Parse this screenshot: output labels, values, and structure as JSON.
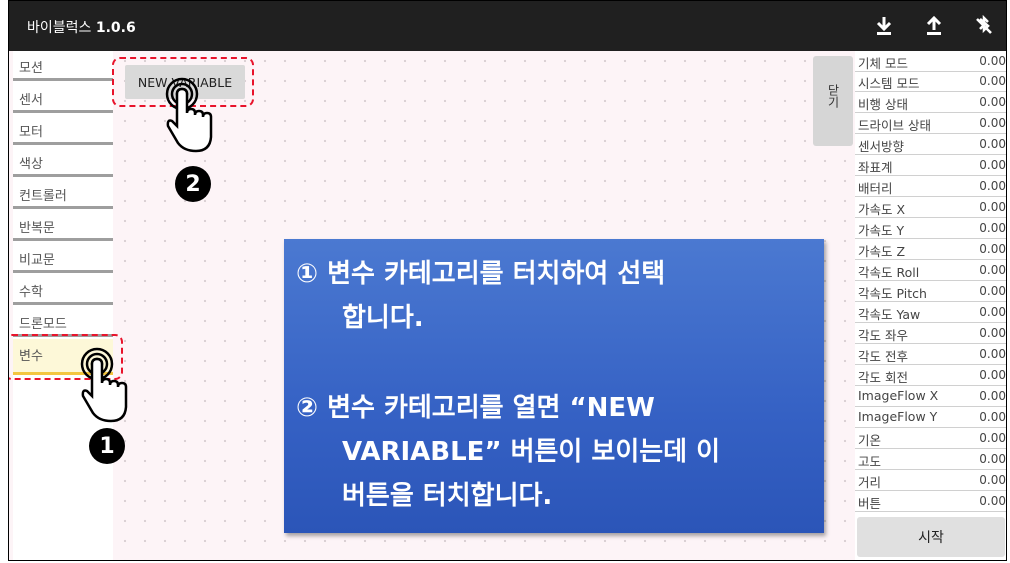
{
  "app": {
    "title": "바이블럭스",
    "version": "1.0.6"
  },
  "toolbar": {
    "icons": [
      "download-icon",
      "upload-icon",
      "bluetooth-off-icon"
    ]
  },
  "categories": [
    {
      "label": "모션",
      "selected": false
    },
    {
      "label": "센서",
      "selected": false
    },
    {
      "label": "모터",
      "selected": false
    },
    {
      "label": "색상",
      "selected": false
    },
    {
      "label": "컨트롤러",
      "selected": false
    },
    {
      "label": "반복문",
      "selected": false
    },
    {
      "label": "비교문",
      "selected": false
    },
    {
      "label": "수학",
      "selected": false
    },
    {
      "label": "드론모드",
      "selected": false
    },
    {
      "label": "변수",
      "selected": true
    }
  ],
  "workspace": {
    "new_variable_label": "NEW VARIABLE",
    "close_label": "닫기"
  },
  "sensors": [
    {
      "name": "기체 모드",
      "value": "0.00"
    },
    {
      "name": "시스템 모드",
      "value": "0.00"
    },
    {
      "name": "비행 상태",
      "value": "0.00"
    },
    {
      "name": "드라이브 상태",
      "value": "0.00"
    },
    {
      "name": "센서방향",
      "value": "0.00"
    },
    {
      "name": "좌표계",
      "value": "0.00"
    },
    {
      "name": "배터리",
      "value": "0.00"
    },
    {
      "name": "가속도 X",
      "value": "0.00"
    },
    {
      "name": "가속도 Y",
      "value": "0.00"
    },
    {
      "name": "가속도 Z",
      "value": "0.00"
    },
    {
      "name": "각속도 Roll",
      "value": "0.00"
    },
    {
      "name": "각속도 Pitch",
      "value": "0.00"
    },
    {
      "name": "각속도 Yaw",
      "value": "0.00"
    },
    {
      "name": "각도 좌우",
      "value": "0.00"
    },
    {
      "name": "각도 전후",
      "value": "0.00"
    },
    {
      "name": "각도 회전",
      "value": "0.00"
    },
    {
      "name": "ImageFlow X",
      "value": "0.00"
    },
    {
      "name": "ImageFlow Y",
      "value": "0.00"
    },
    {
      "name": "기온",
      "value": "0.00"
    },
    {
      "name": "고도",
      "value": "0.00"
    },
    {
      "name": "거리",
      "value": "0.00"
    },
    {
      "name": "버튼",
      "value": "0.00"
    }
  ],
  "start_label": "시작",
  "annotations": {
    "step1_badge": "1",
    "step2_badge": "2",
    "callout_lines": [
      "① 변수 카테고리를 터치하여 선택",
      "합니다.",
      "② 변수 카테고리를 열면 “NEW",
      "VARIABLE” 버튼이 보이는데 이",
      "버튼을 터치합니다."
    ],
    "highlight_color": "#e8132b",
    "callout_color": "#3a66c8"
  }
}
